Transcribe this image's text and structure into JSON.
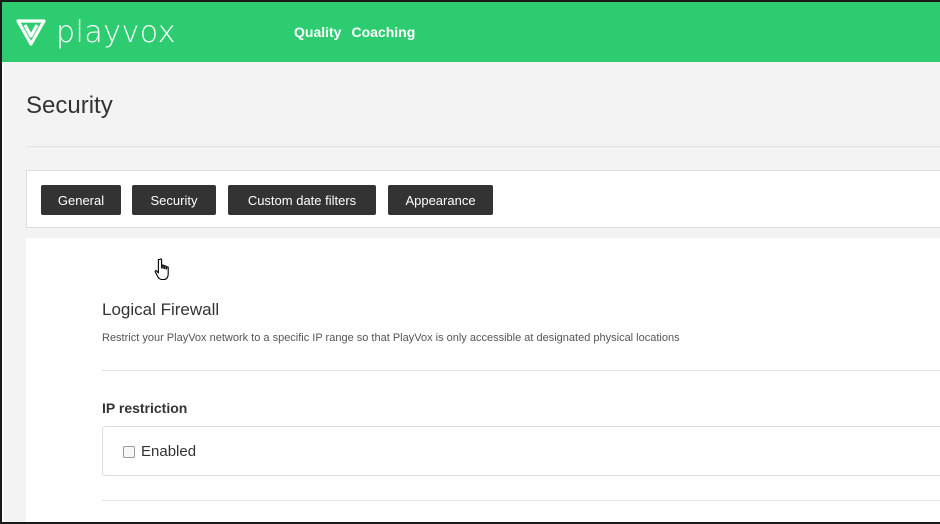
{
  "app": {
    "brand_name": "playvox",
    "brand_color": "#2ecc71"
  },
  "nav": {
    "items": [
      {
        "label": "Quality"
      },
      {
        "label": "Coaching"
      }
    ]
  },
  "page": {
    "title": "Security"
  },
  "tabs": {
    "active": "Security",
    "items": [
      {
        "label": "General"
      },
      {
        "label": "Security"
      },
      {
        "label": "Custom date filters"
      },
      {
        "label": "Appearance"
      }
    ]
  },
  "firewall": {
    "title": "Logical Firewall",
    "description": "Restrict your PlayVox network to a specific IP range so that PlayVox is only accessible at designated physical locations",
    "ip_restriction": {
      "label": "IP restriction",
      "checkbox_label": "Enabled",
      "checked": false
    }
  },
  "icons": {
    "logo": "playvox-logo-icon",
    "cursor": "hand-pointer-icon"
  }
}
